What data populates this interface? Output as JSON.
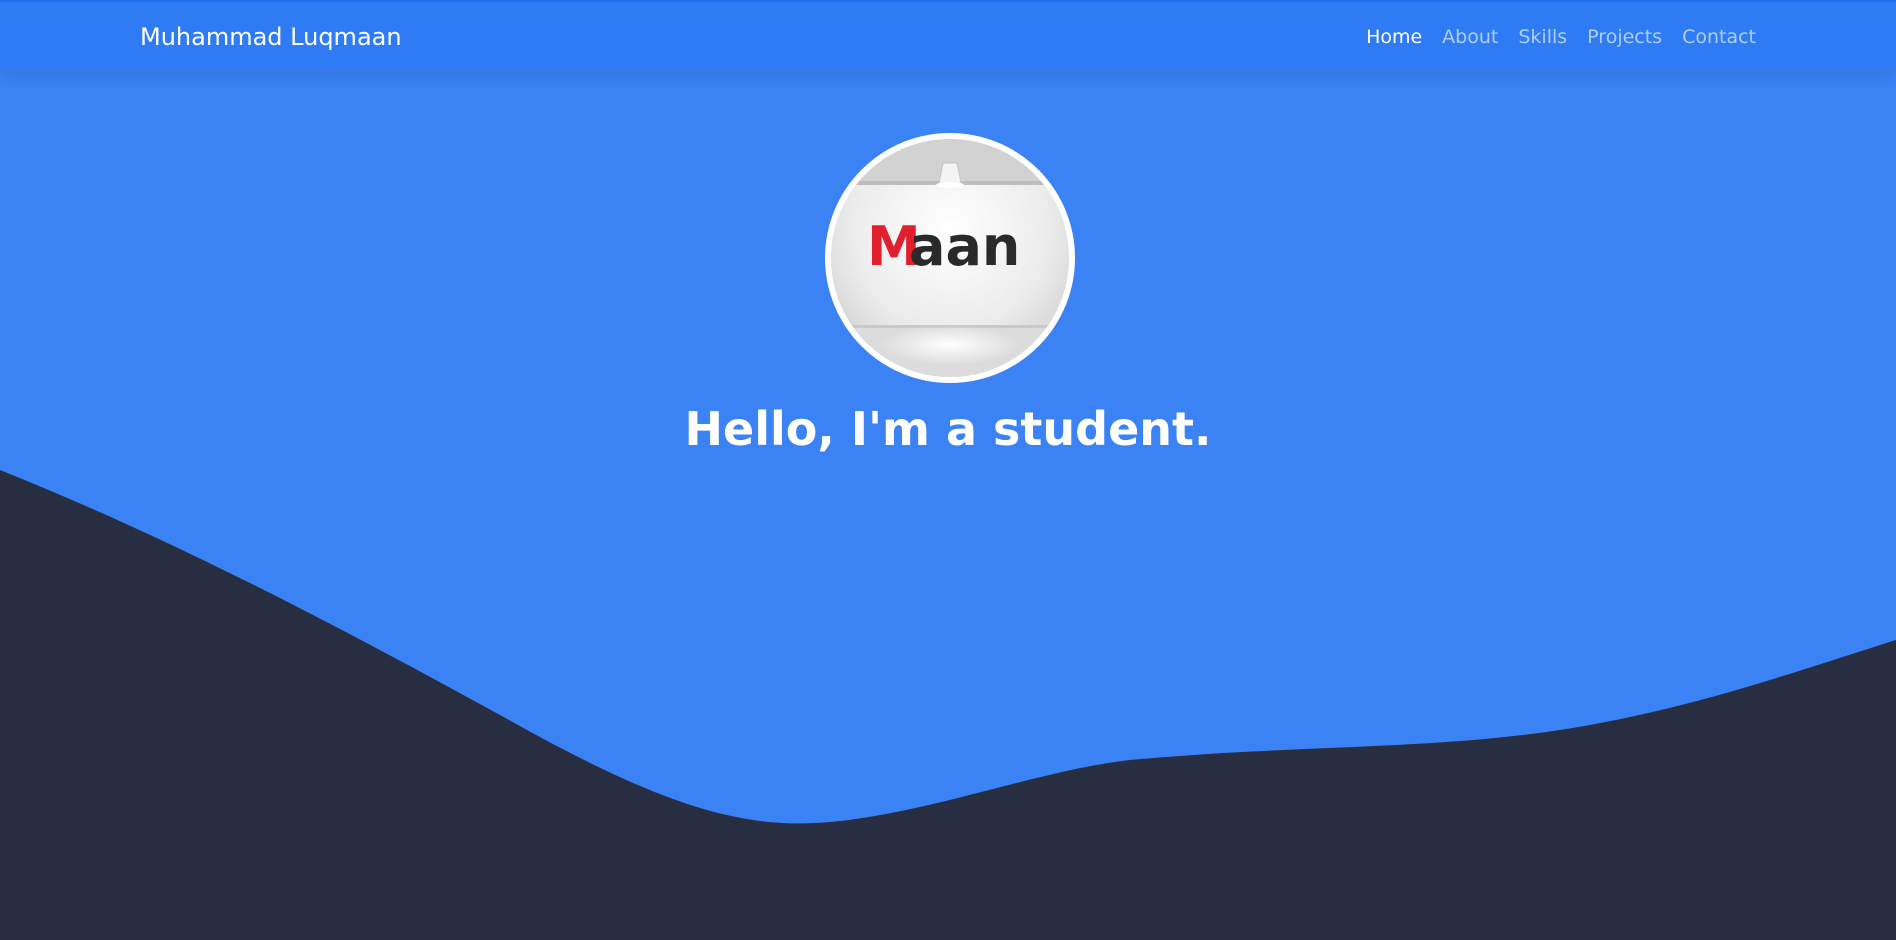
{
  "nav": {
    "brand": "Muhammad Luqmaan",
    "links": [
      {
        "label": "Home",
        "active": true
      },
      {
        "label": "About",
        "active": false
      },
      {
        "label": "Skills",
        "active": false
      },
      {
        "label": "Projects",
        "active": false
      },
      {
        "label": "Contact",
        "active": false
      }
    ]
  },
  "hero": {
    "logo_text": "Maan",
    "headline": "Hello, I'm a student."
  },
  "colors": {
    "navbar": "#2e7bf3",
    "hero": "#3b82f4",
    "wave": "#282e41",
    "logo_accent": "#e0202e",
    "logo_text": "#2a2a2a"
  }
}
